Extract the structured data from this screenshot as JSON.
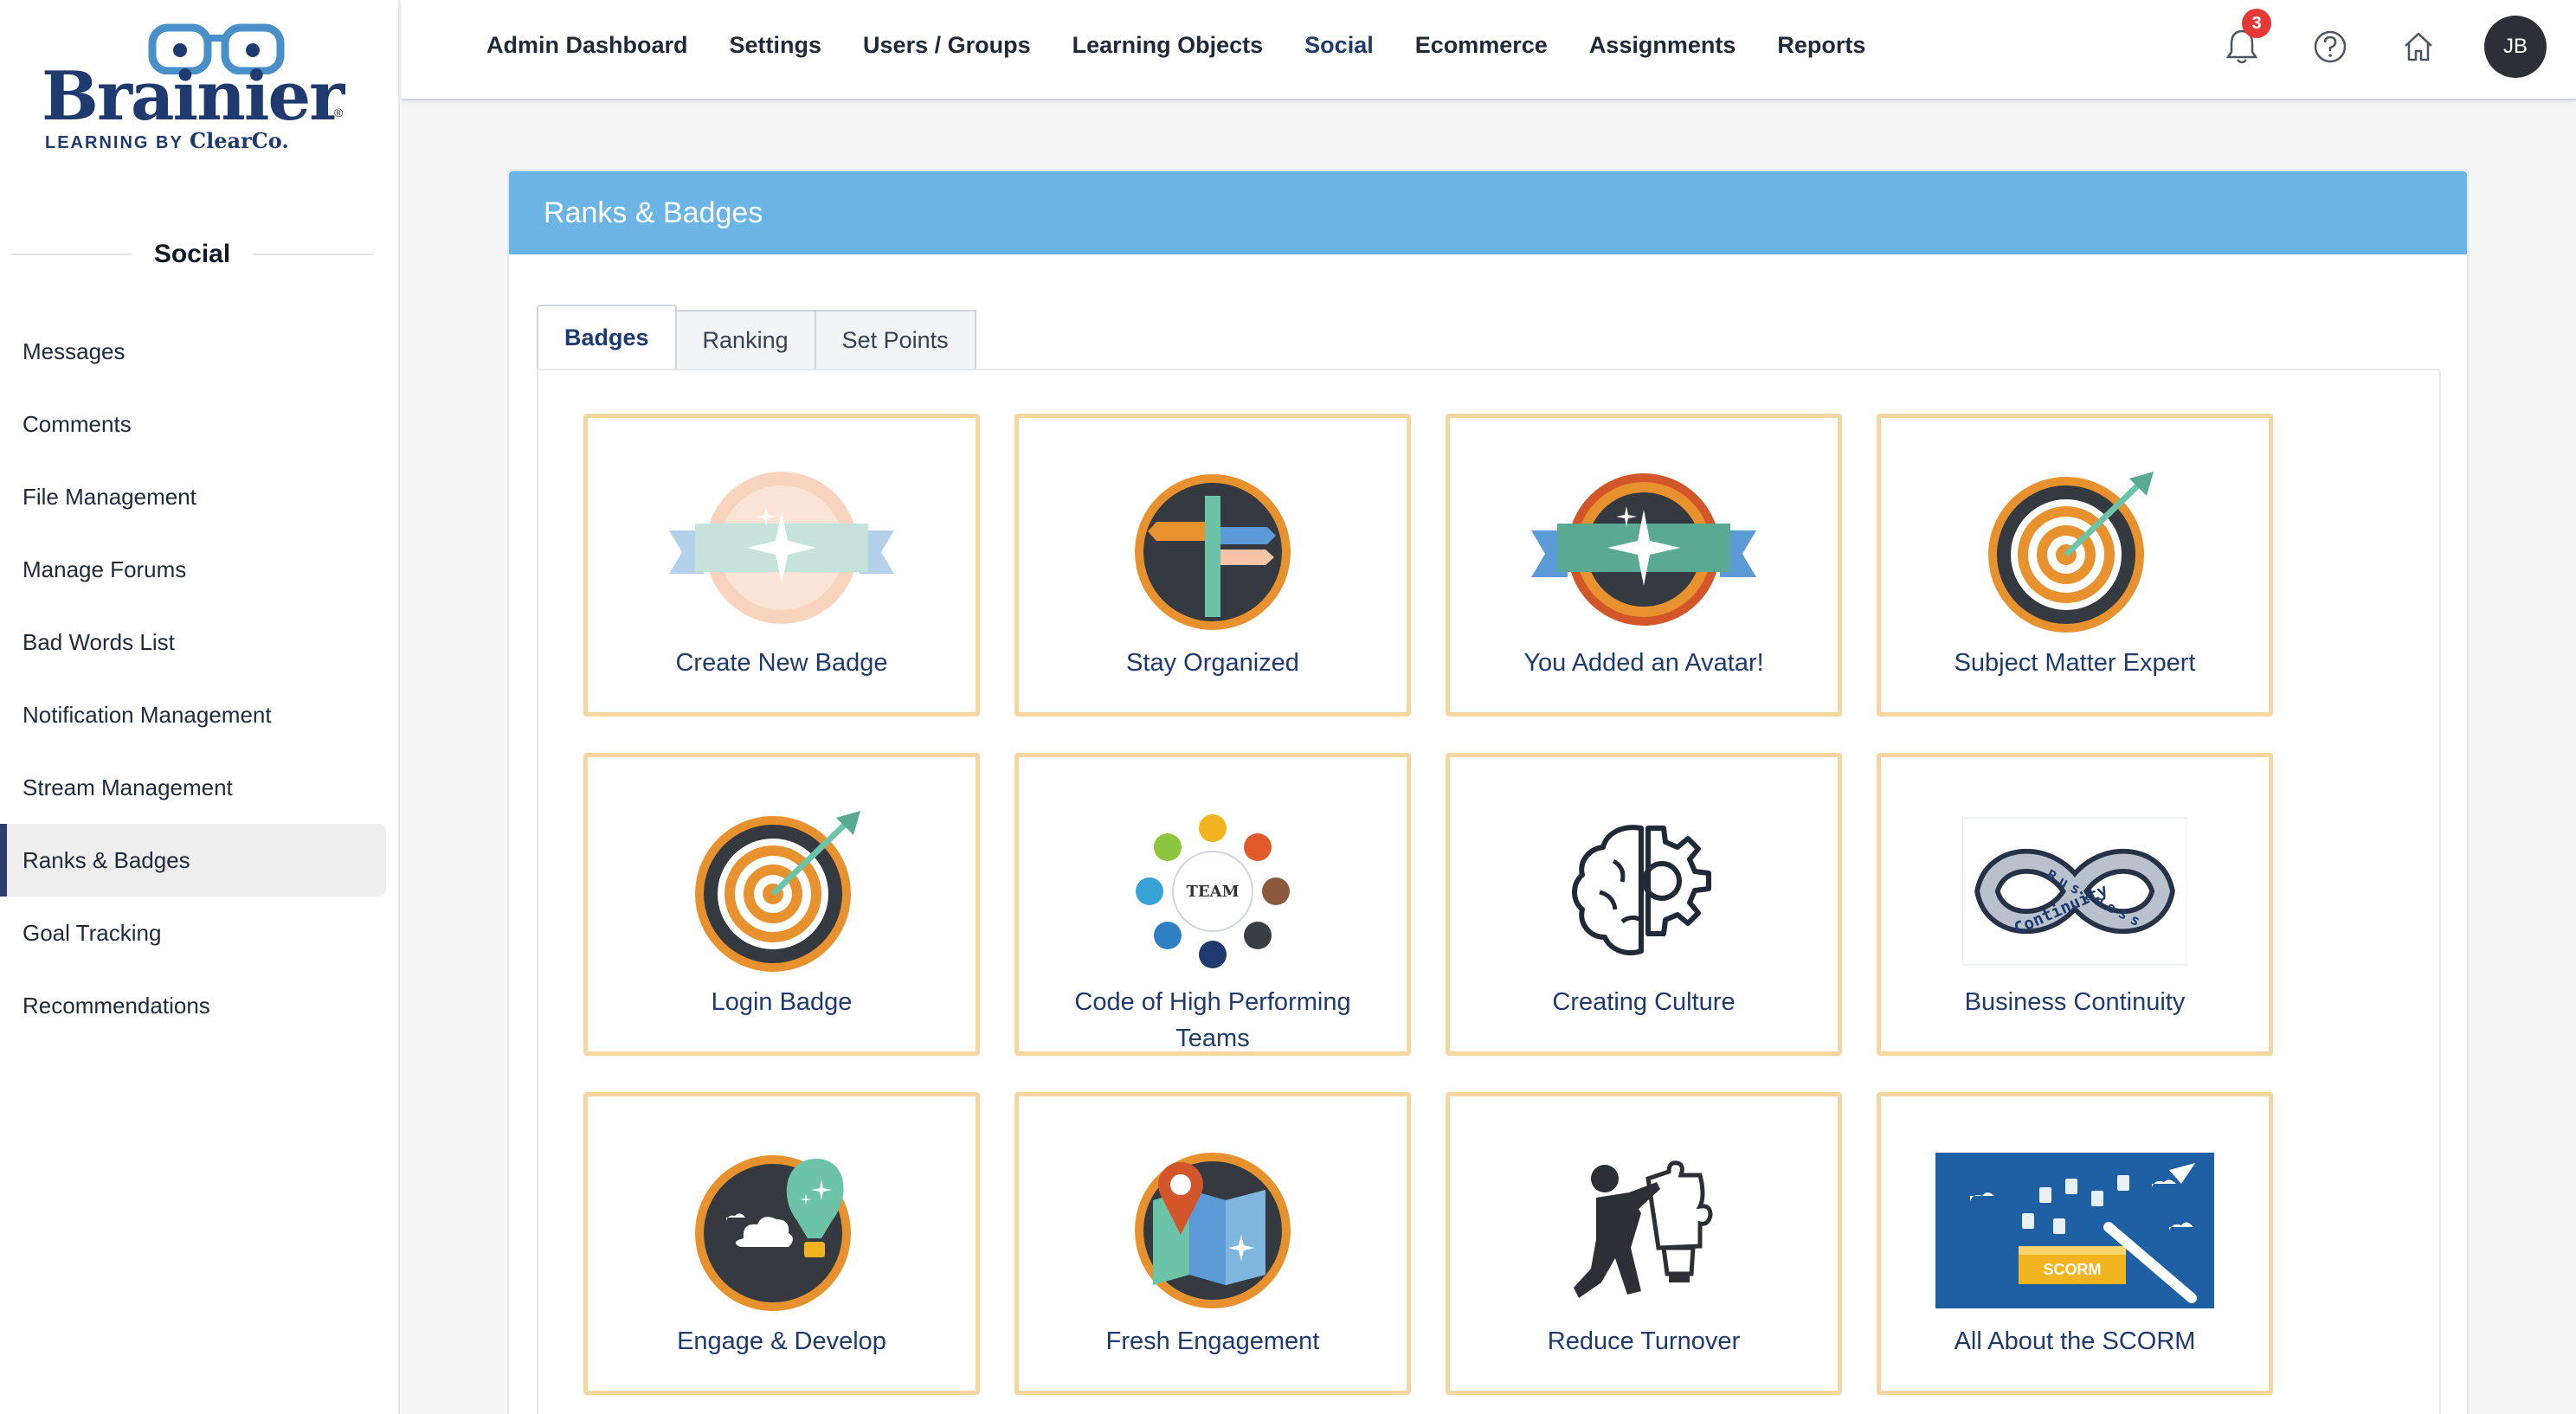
{
  "brand": {
    "name": "Brainier",
    "tagline": "LEARNING BY",
    "tagline_brand": "ClearCo.",
    "tm": "®"
  },
  "topnav": [
    {
      "label": "Admin Dashboard",
      "active": false
    },
    {
      "label": "Settings",
      "active": false
    },
    {
      "label": "Users / Groups",
      "active": false
    },
    {
      "label": "Learning Objects",
      "active": false
    },
    {
      "label": "Social",
      "active": true
    },
    {
      "label": "Ecommerce",
      "active": false
    },
    {
      "label": "Assignments",
      "active": false
    },
    {
      "label": "Reports",
      "active": false
    }
  ],
  "topbar": {
    "notifications_count": "3",
    "user_initials": "JB",
    "icons": [
      "bell-icon",
      "help-icon",
      "home-icon"
    ]
  },
  "sidebar": {
    "heading": "Social",
    "items": [
      {
        "label": "Messages"
      },
      {
        "label": "Comments"
      },
      {
        "label": "File Management"
      },
      {
        "label": "Manage Forums"
      },
      {
        "label": "Bad Words List"
      },
      {
        "label": "Notification Management"
      },
      {
        "label": "Stream Management"
      },
      {
        "label": "Ranks & Badges",
        "active": true
      },
      {
        "label": "Goal Tracking"
      },
      {
        "label": "Recommendations"
      }
    ]
  },
  "panel": {
    "title": "Ranks & Badges",
    "tabs": [
      {
        "label": "Badges",
        "active": true
      },
      {
        "label": "Ranking",
        "active": false
      },
      {
        "label": "Set Points",
        "active": false
      }
    ],
    "badges": [
      {
        "label": "Create New Badge",
        "icon": "sparkle-banner-faded"
      },
      {
        "label": "Stay Organized",
        "icon": "signpost"
      },
      {
        "label": "You Added an Avatar!",
        "icon": "sparkle-banner"
      },
      {
        "label": "Subject Matter Expert",
        "icon": "target-arrow"
      },
      {
        "label": "Login Badge",
        "icon": "target-arrow"
      },
      {
        "label": "Code of High Performing Teams",
        "icon": "team-circle"
      },
      {
        "label": "Creating Culture",
        "icon": "brain-gear"
      },
      {
        "label": "Business Continuity",
        "icon": "infinity"
      },
      {
        "label": "Engage & Develop",
        "icon": "balloon"
      },
      {
        "label": "Fresh Engagement",
        "icon": "map-pin"
      },
      {
        "label": "Reduce Turnover",
        "icon": "puzzle-person"
      },
      {
        "label": "All About the SCORM",
        "icon": "scorm"
      }
    ],
    "team_word": "TEAM",
    "infinity_words": [
      "Business",
      "Continuity"
    ],
    "scorm_word": "SCORM"
  },
  "colors": {
    "accent": "#6bb5e6",
    "navy": "#1e3a6e",
    "card_border": "#f5d6a0",
    "badge_orange": "#e8912f"
  }
}
